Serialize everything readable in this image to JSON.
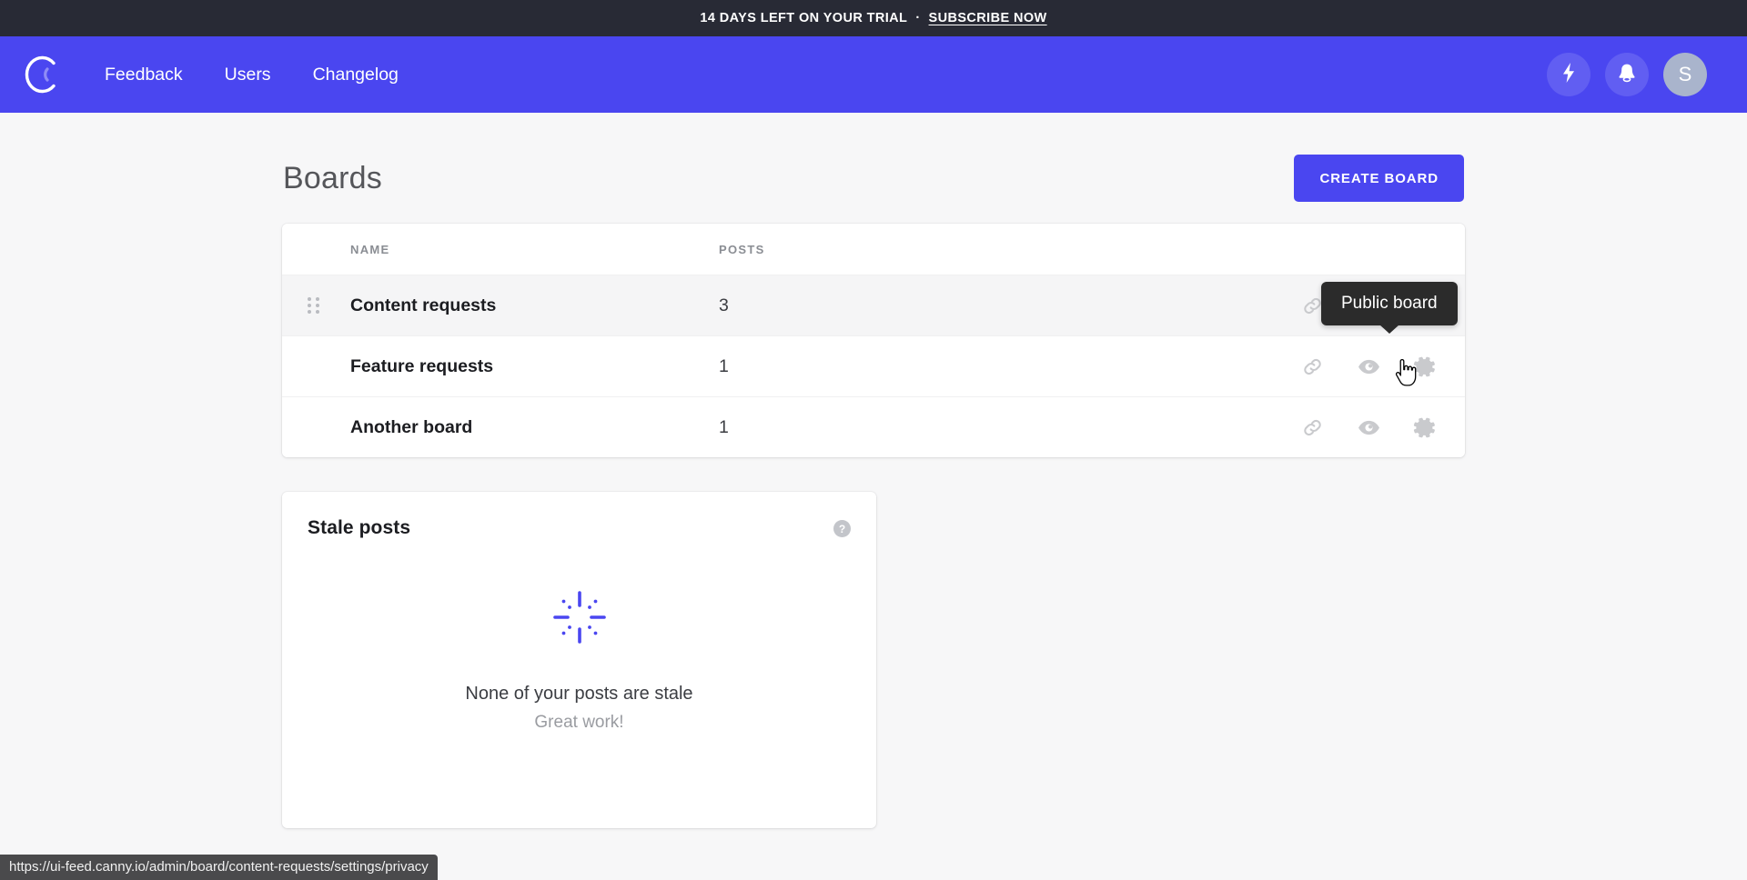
{
  "banner": {
    "text": "14 DAYS LEFT ON YOUR TRIAL",
    "separator": "·",
    "link_label": "SUBSCRIBE NOW"
  },
  "topnav": {
    "logo_name": "canny-logo",
    "links": [
      {
        "label": "Feedback"
      },
      {
        "label": "Users"
      },
      {
        "label": "Changelog"
      }
    ],
    "actions": [
      {
        "name": "lightning-icon"
      },
      {
        "name": "bell-icon"
      }
    ],
    "avatar_initial": "S",
    "brand_color": "#4a46f0",
    "avatar_color": "#a9b4cc"
  },
  "page": {
    "title": "Boards",
    "create_board_label": "CREATE BOARD"
  },
  "boards_table": {
    "columns": {
      "name": "NAME",
      "posts": "POSTS"
    },
    "rows": [
      {
        "name": "Content requests",
        "posts": "3"
      },
      {
        "name": "Feature requests",
        "posts": "1"
      },
      {
        "name": "Another board",
        "posts": "1"
      }
    ],
    "row_actions": [
      {
        "name": "link-icon"
      },
      {
        "name": "eye-icon"
      },
      {
        "name": "gear-icon"
      }
    ]
  },
  "tooltip": {
    "text": "Public board"
  },
  "stale_posts": {
    "title": "Stale posts",
    "help_label": "?",
    "empty_primary": "None of your posts are stale",
    "empty_secondary": "Great work!",
    "icon_name": "sparkle-burst-icon",
    "icon_color": "#4a46f0"
  },
  "status_bar": {
    "url": "https://ui-feed.canny.io/admin/board/content-requests/settings/privacy"
  }
}
